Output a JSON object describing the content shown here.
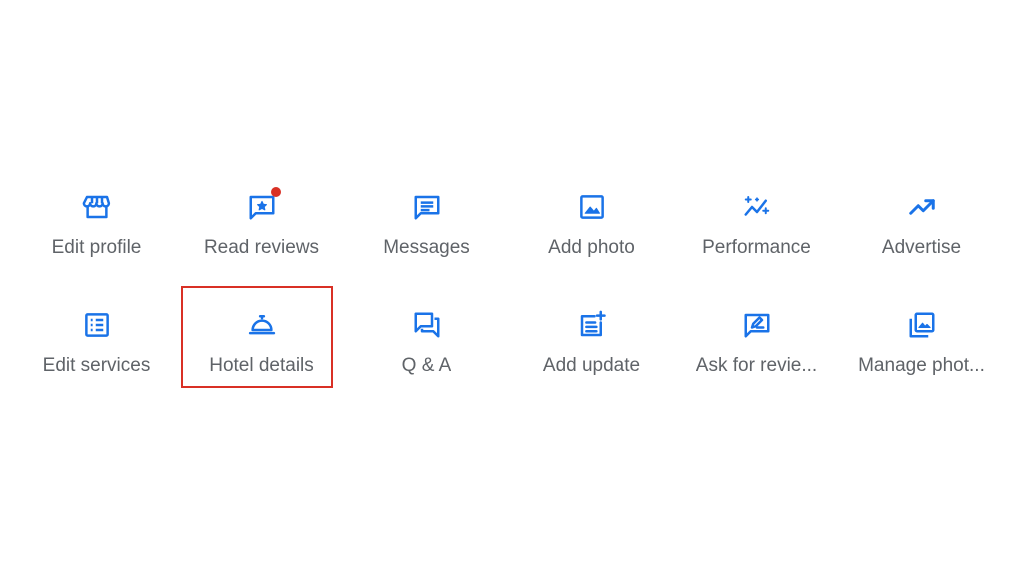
{
  "colors": {
    "icon": "#1a73e8",
    "label": "#5f6368",
    "badge": "#d93025",
    "highlight": "#d93025"
  },
  "tiles": [
    {
      "label": "Edit profile",
      "icon": "storefront-icon"
    },
    {
      "label": "Read reviews",
      "icon": "review-star-icon",
      "badge": true
    },
    {
      "label": "Messages",
      "icon": "message-icon"
    },
    {
      "label": "Add photo",
      "icon": "image-icon"
    },
    {
      "label": "Performance",
      "icon": "performance-sparkle-icon"
    },
    {
      "label": "Advertise",
      "icon": "trending-up-icon"
    },
    {
      "label": "Edit services",
      "icon": "list-icon"
    },
    {
      "label": "Hotel details",
      "icon": "room-service-bell-icon",
      "selected": true
    },
    {
      "label": "Q & A",
      "icon": "forum-icon"
    },
    {
      "label": "Add update",
      "icon": "post-add-icon"
    },
    {
      "label": "Ask for revie...",
      "icon": "rate-review-icon"
    },
    {
      "label": "Manage phot...",
      "icon": "photo-library-icon"
    }
  ]
}
